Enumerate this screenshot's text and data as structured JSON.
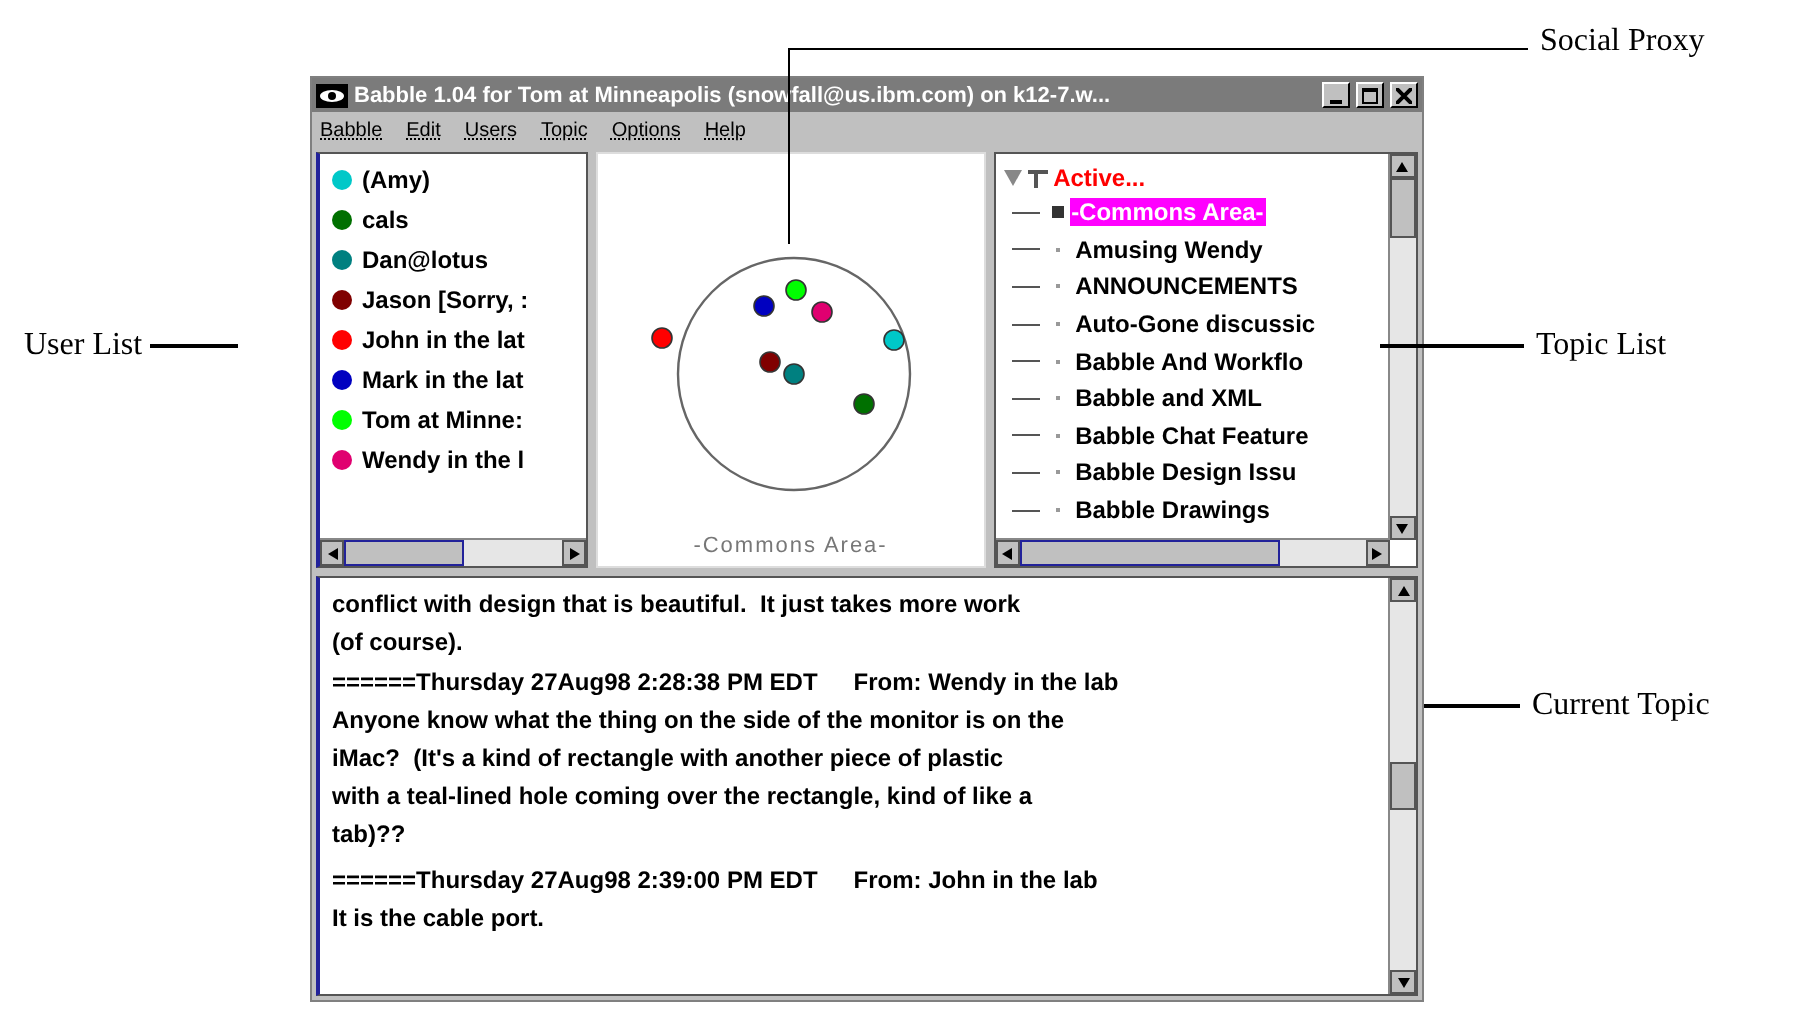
{
  "window": {
    "title": "Babble 1.04 for Tom at Minneapolis (snowfall@us.ibm.com) on k12-7.w..."
  },
  "menu": [
    "Babble",
    "Edit",
    "Users",
    "Topic",
    "Options",
    "Help"
  ],
  "users": [
    {
      "name": "(Amy)",
      "color": "#00c8c8"
    },
    {
      "name": "cals",
      "color": "#007000"
    },
    {
      "name": "Dan@lotus",
      "color": "#008080"
    },
    {
      "name": "Jason [Sorry, :",
      "color": "#800000"
    },
    {
      "name": "John in the lat",
      "color": "#ff0000"
    },
    {
      "name": "Mark in the lat",
      "color": "#0000c0"
    },
    {
      "name": "Tom at Minne:",
      "color": "#00ff00"
    },
    {
      "name": "Wendy in the l",
      "color": "#e00070"
    }
  ],
  "proxy": {
    "caption": "-Commons Area-"
  },
  "topics": {
    "label": "Active...",
    "expanded": true,
    "children": [
      {
        "label": "-Commons Area-",
        "selected": true
      },
      {
        "label": "Amusing Wendy",
        "selected": false
      },
      {
        "label": "ANNOUNCEMENTS",
        "selected": false
      },
      {
        "label": "Auto-Gone discussic",
        "selected": false
      },
      {
        "label": "Babble And Workflo",
        "selected": false
      },
      {
        "label": "Babble and XML",
        "selected": false
      },
      {
        "label": "Babble Chat Feature",
        "selected": false
      },
      {
        "label": "Babble Design Issu",
        "selected": false
      },
      {
        "label": "Babble Drawings",
        "selected": false
      }
    ]
  },
  "messages": [
    {
      "kind": "text",
      "lines": [
        "conflict with design that is beautiful.  It just takes more work",
        "(of course)."
      ]
    },
    {
      "kind": "header",
      "date": "======Thursday 27Aug98 2:28:38 PM EDT",
      "from": "From: Wendy in the lab"
    },
    {
      "kind": "text",
      "lines": [
        "Anyone know what the thing on the side of the monitor is on the",
        "iMac?  (It's a kind of rectangle with another piece of plastic",
        "with a teal-lined hole coming over the rectangle, kind of like a",
        "tab)??"
      ]
    },
    {
      "kind": "header",
      "date": "======Thursday 27Aug98 2:39:00 PM EDT",
      "from": "From: John in the lab"
    },
    {
      "kind": "text",
      "lines": [
        "It is the cable port."
      ]
    }
  ],
  "callouts": [
    {
      "kind": "social",
      "label": "Social Proxy"
    },
    {
      "kind": "users",
      "label": "User List"
    },
    {
      "kind": "topics",
      "label": "Topic List"
    },
    {
      "kind": "current",
      "label": "Current Topic"
    }
  ]
}
